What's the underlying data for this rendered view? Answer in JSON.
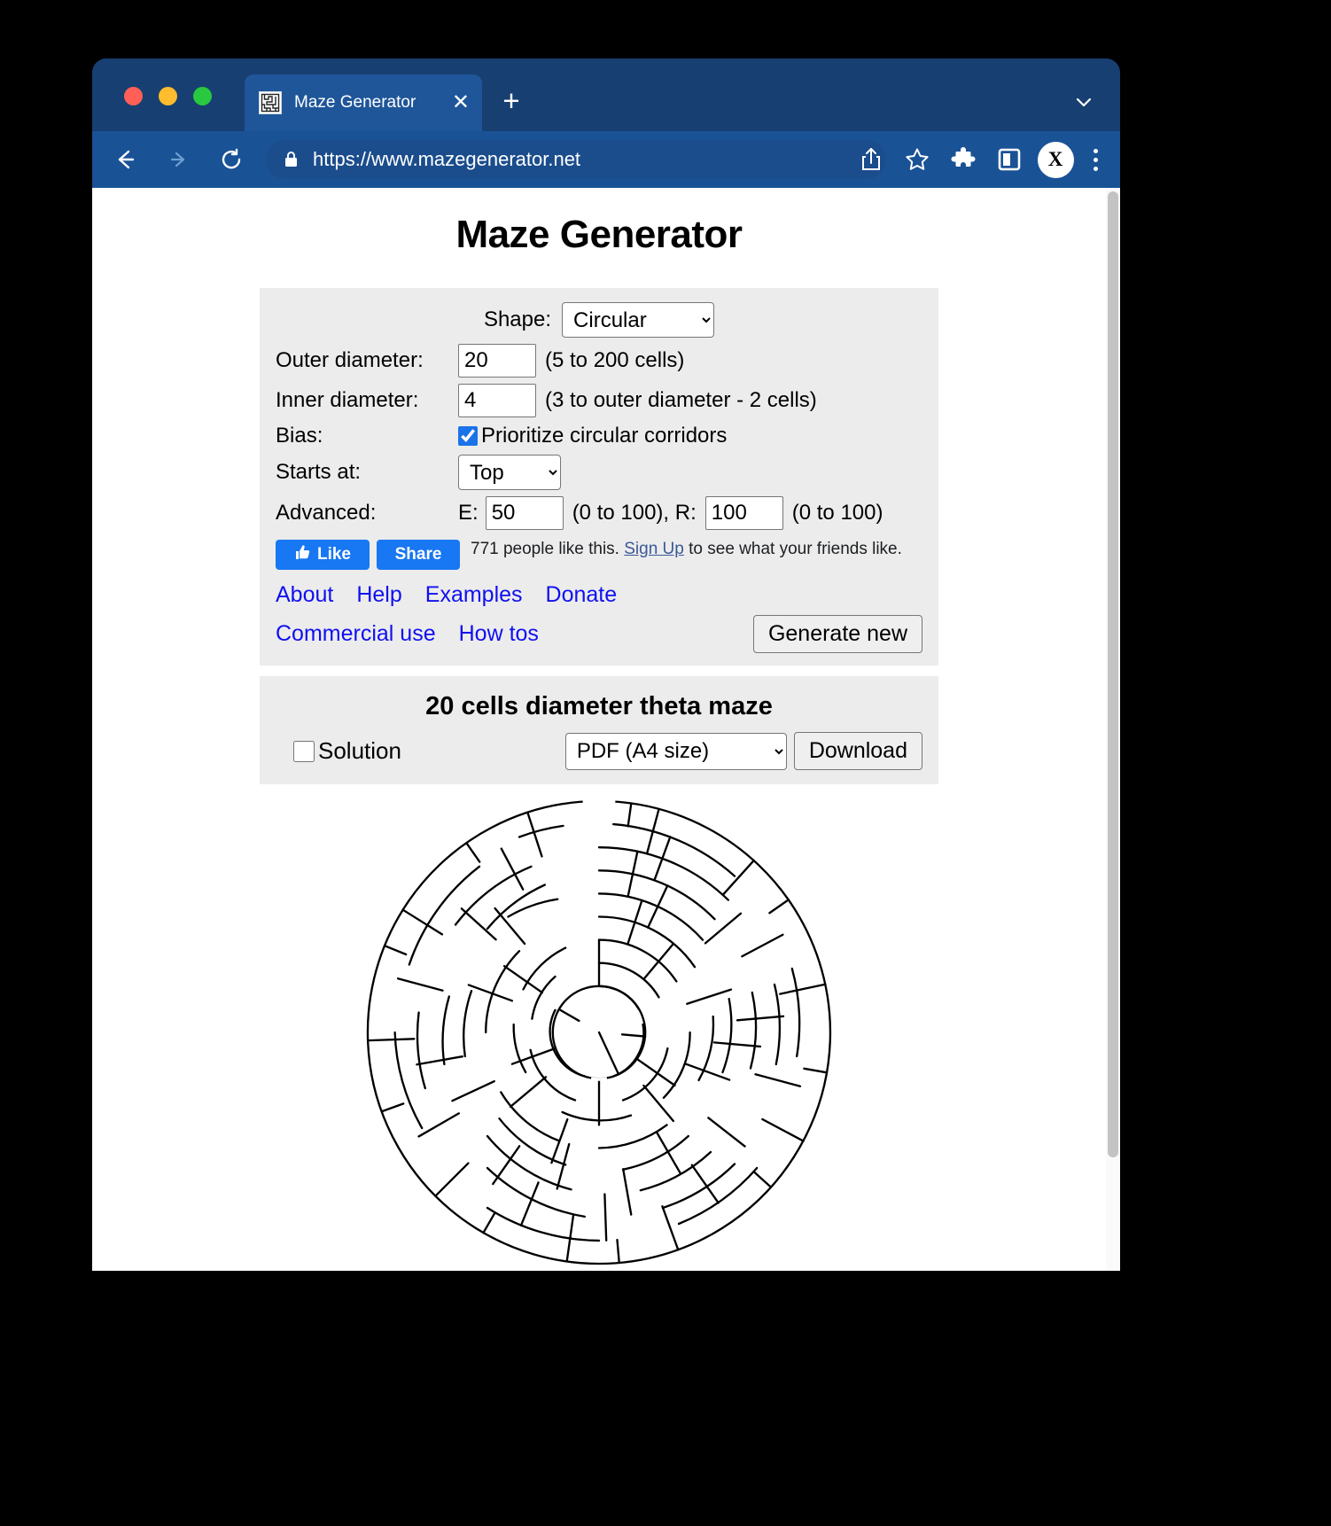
{
  "browser": {
    "tab": {
      "title": "Maze Generator",
      "favicon_name": "maze-favicon",
      "close_label": "✕"
    },
    "new_tab_label": "+",
    "toolbar": {
      "url": "https://www.mazegenerator.net",
      "back_icon": "back-arrow-icon",
      "forward_icon": "forward-arrow-icon",
      "reload_icon": "reload-icon",
      "lock_icon": "lock-icon",
      "share_icon": "share-icon",
      "bookmark_icon": "star-icon",
      "extensions_icon": "puzzle-icon",
      "sidepanel_icon": "side-panel-icon",
      "profile_initial": "X",
      "menu_icon": "three-dots-icon"
    }
  },
  "page": {
    "title": "Maze Generator",
    "settings": {
      "shape_label": "Shape:",
      "shape_value": "Circular",
      "shape_options": [
        "Circular"
      ],
      "outer_diameter_label": "Outer diameter:",
      "outer_diameter_value": "20",
      "outer_diameter_hint": "(5 to 200 cells)",
      "inner_diameter_label": "Inner diameter:",
      "inner_diameter_value": "4",
      "inner_diameter_hint": "(3 to outer diameter - 2 cells)",
      "bias_label": "Bias:",
      "bias_checkbox_label": "Prioritize circular corridors",
      "bias_checked": true,
      "starts_at_label": "Starts at:",
      "starts_at_value": "Top",
      "starts_at_options": [
        "Top"
      ],
      "advanced_label": "Advanced:",
      "advanced_e_label": "E:",
      "advanced_e_value": "50",
      "advanced_e_hint": "(0 to 100), R:",
      "advanced_r_value": "100",
      "advanced_r_hint": "(0 to 100)",
      "generate_button": "Generate new"
    },
    "social": {
      "like_label": "Like",
      "share_label": "Share",
      "text_before": "771 people like this. ",
      "signup_link": "Sign Up",
      "text_after": " to see what your friends like."
    },
    "links_row_1": [
      "About",
      "Help",
      "Examples",
      "Donate"
    ],
    "links_row_2": [
      "Commercial use",
      "How tos"
    ],
    "maze_panel": {
      "title": "20 cells diameter theta maze",
      "solution_label": "Solution",
      "solution_checked": false,
      "format_value": "PDF (A4 size)",
      "format_options": [
        "PDF (A4 size)"
      ],
      "download_button": "Download"
    }
  },
  "colors": {
    "browser_chrome": "#1a5296",
    "tab_strip": "#173f71",
    "panel_bg": "#ececec",
    "link_blue": "#1010f0",
    "facebook_blue": "#1877f2",
    "accent_checkbox": "#1a73e8"
  }
}
